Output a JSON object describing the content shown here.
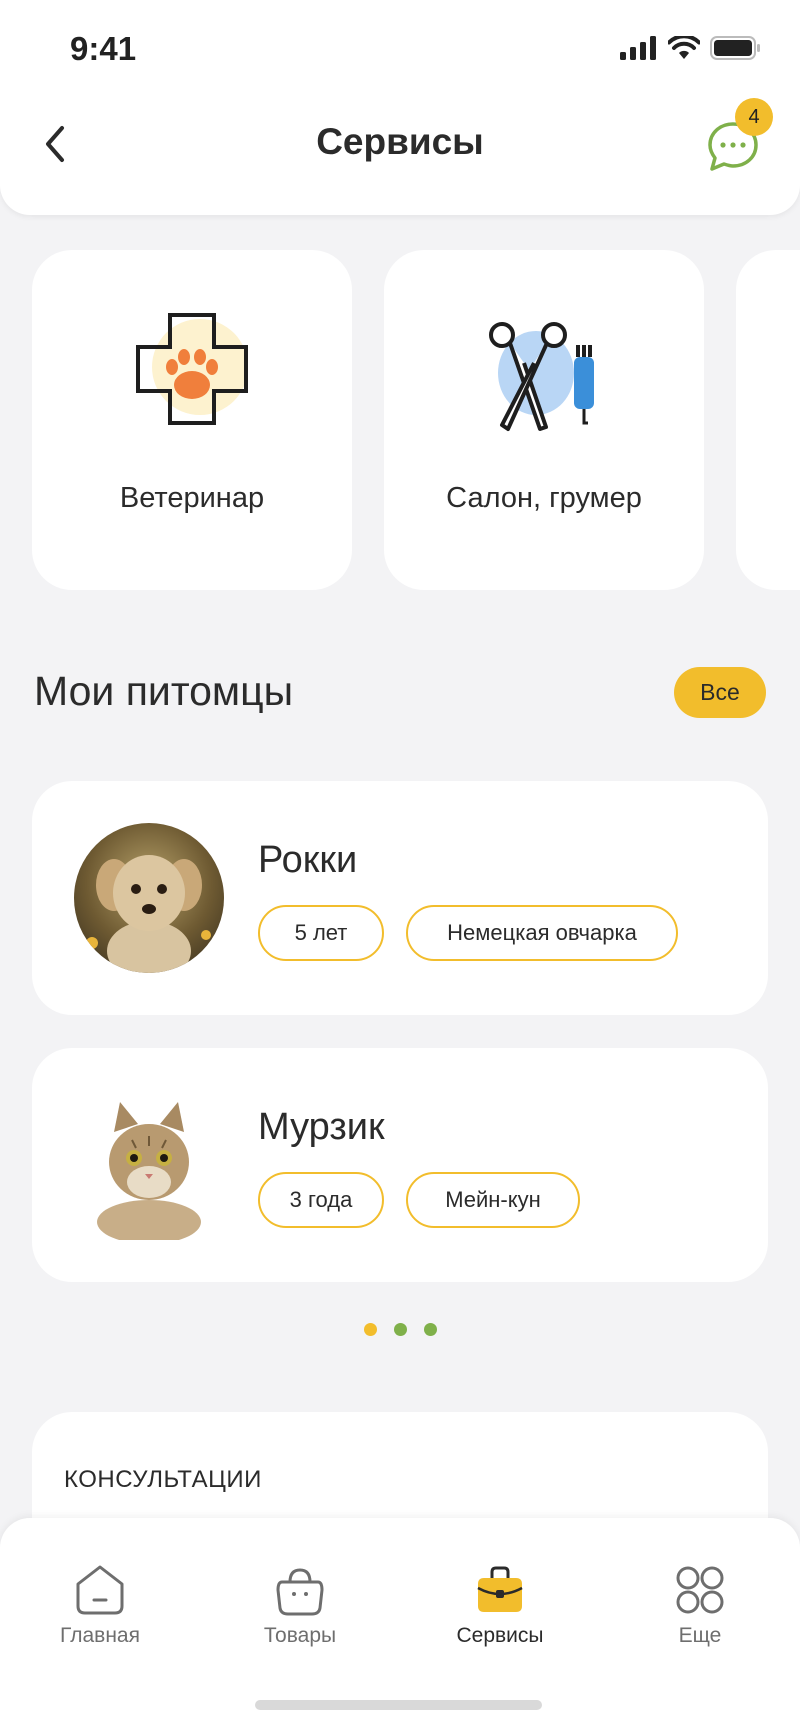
{
  "status_bar": {
    "time": "9:41"
  },
  "header": {
    "title": "Сервисы",
    "chat_badge_count": "4"
  },
  "services": [
    {
      "label": "Ветеринар",
      "icon": "vet-cross-paw-icon"
    },
    {
      "label": "Салон, грумер",
      "icon": "scissors-clipper-icon"
    }
  ],
  "pets_section": {
    "title": "Мои питомцы",
    "all_label": "Все"
  },
  "pets": [
    {
      "name": "Рокки",
      "age": "5 лет",
      "breed": "Немецкая овчарка",
      "avatar": "dog-photo"
    },
    {
      "name": "Мурзик",
      "age": "3 года",
      "breed": "Мейн-кун",
      "avatar": "cat-photo"
    }
  ],
  "carousel": {
    "count": 3,
    "active_index": 0
  },
  "consultations": {
    "title": "КОНСУЛЬТАЦИИ"
  },
  "tabbar": {
    "items": [
      {
        "label": "Главная",
        "icon": "home-icon",
        "active": false
      },
      {
        "label": "Товары",
        "icon": "bag-icon",
        "active": false
      },
      {
        "label": "Сервисы",
        "icon": "briefcase-icon",
        "active": true
      },
      {
        "label": "Еще",
        "icon": "more-grid-icon",
        "active": false
      }
    ]
  },
  "colors": {
    "accent": "#f2bd2c",
    "green": "#7fb04a",
    "orange": "#f07f3c",
    "blue": "#b9d6f5",
    "background": "#f3f3f5"
  }
}
